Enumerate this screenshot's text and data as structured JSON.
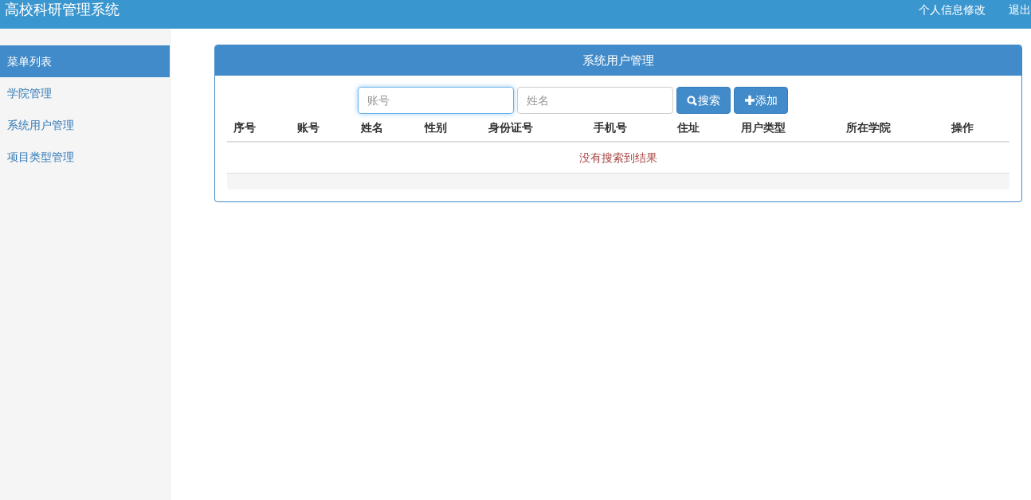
{
  "header": {
    "title": "高校科研管理系统",
    "links": [
      "个人信息修改",
      "退出"
    ]
  },
  "sidebar": {
    "items": [
      {
        "label": "菜单列表",
        "selected": true
      },
      {
        "label": "学院管理",
        "selected": false
      },
      {
        "label": "系统用户管理",
        "selected": false
      },
      {
        "label": "项目类型管理",
        "selected": false
      }
    ]
  },
  "panel": {
    "title": "系统用户管理",
    "search": {
      "fields": [
        {
          "placeholder": "账号",
          "focused": true
        },
        {
          "placeholder": "姓名",
          "focused": false
        }
      ],
      "buttons": [
        {
          "kind": "search",
          "label": "搜索"
        },
        {
          "kind": "add",
          "label": "添加"
        }
      ]
    },
    "table": {
      "columns": [
        "序号",
        "账号",
        "姓名",
        "性别",
        "身份证号",
        "手机号",
        "住址",
        "用户类型",
        "所在学院",
        "操作"
      ],
      "empty_message": "没有搜索到结果"
    }
  }
}
